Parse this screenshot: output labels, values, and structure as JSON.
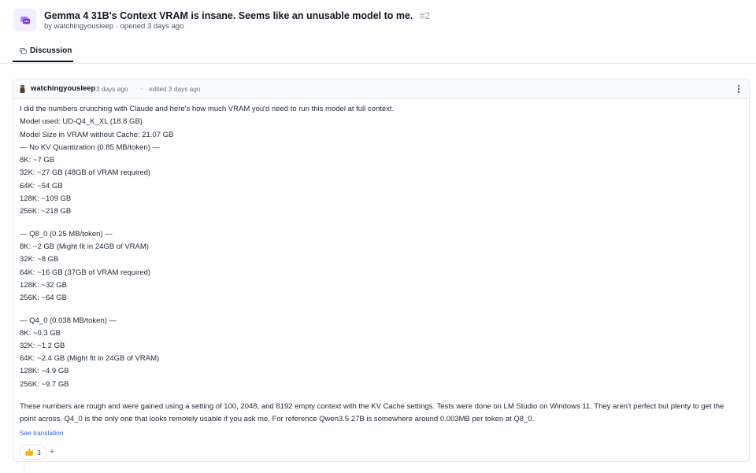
{
  "discussion": {
    "title": "Gemma 4 31B's Context VRAM is insane. Seems like an unusable model to me.",
    "number": "#2",
    "subline": "by watchingyousleep · opened 3 days ago"
  },
  "tabs": [
    {
      "label": "Discussion"
    }
  ],
  "post": {
    "author": "watchingyousleep",
    "time": "3 days ago",
    "separator": "·",
    "edited": "edited 3 days ago",
    "lines": [
      "I did the numbers crunching with Claude and here's how much VRAM you'd need to run this model at full context.",
      "Model used: UD-Q4_K_XL (18.8 GB)",
      "Model Size in VRAM without Cache: 21.07 GB",
      "— No KV Quantization (0.85 MB/token) —",
      "8K: ~7 GB",
      "32K: ~27 GB (48GB of VRAM required)",
      "64K: ~54 GB",
      "128K: ~109 GB",
      "256K: ~218 GB",
      "— Q8_0 (0.25 MB/token) —",
      "8K: ~2 GB (Might fit in 24GB of VRAM)",
      "32K: ~8 GB",
      "64K: ~16 GB (37GB of VRAM required)",
      "128K: ~32 GB",
      "256K: ~64 GB",
      "— Q4_0 (0.038 MB/token) —",
      "8K: ~0.3 GB",
      "32K: ~1.2 GB",
      "64K: ~2.4 GB (Might fit in 24GB of VRAM)",
      "128K: ~4.9 GB",
      "256K: ~9.7 GB"
    ],
    "closing": "These numbers are rough and were gained using a setting of 100, 2048, and 8192 empty context with the KV Cache settings. Tests were done on LM Studio on Windows 11. They aren't perfect but plenty to get the point across. Q4_0 is the only one that looks remotely usable if you ask me. For reference Qwen3.5 27B is somewhere around 0.003MB per token at Q8_0.",
    "see_translation": "See translation",
    "reaction_count": "3",
    "add_reaction": "+"
  },
  "colors": {
    "accent": "#7c3aed",
    "link": "#2563eb",
    "thumbs": "#f5b301"
  }
}
